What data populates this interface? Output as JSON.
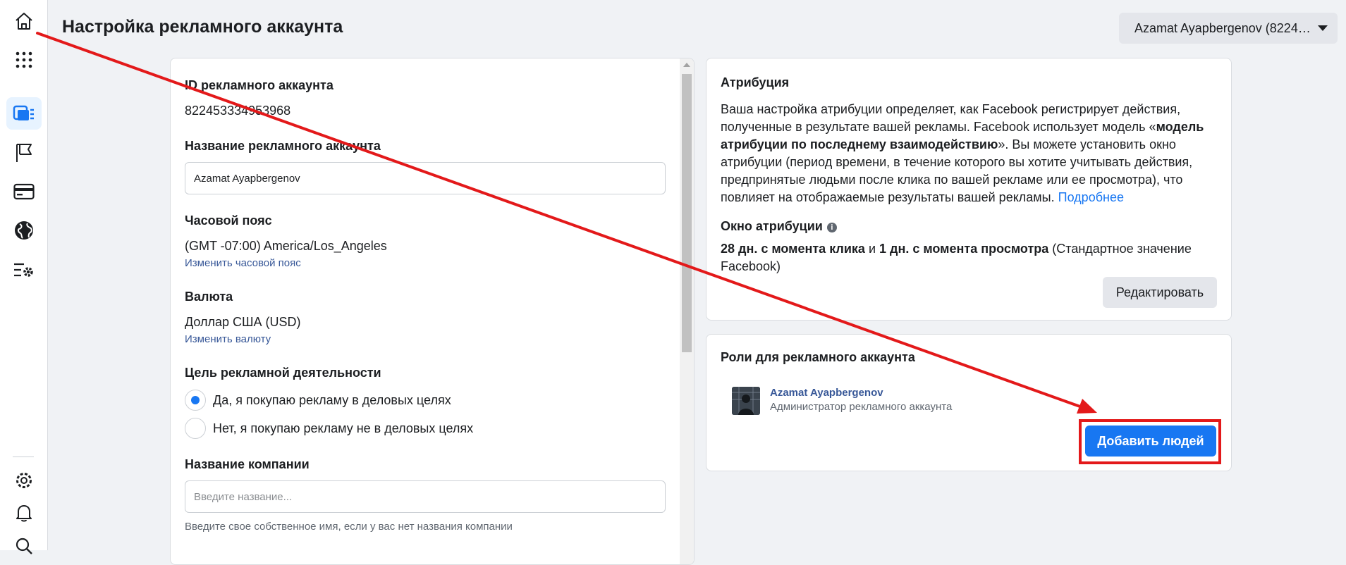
{
  "sidebar": {
    "icons": [
      "home-icon",
      "apps-grid-icon",
      "ads-manager-icon",
      "flag-icon",
      "billing-card-icon",
      "globe-icon",
      "settings-list-icon",
      "gear-icon",
      "bell-icon",
      "search-icon"
    ],
    "active": "ads-manager-icon",
    "accent": "#1877f2"
  },
  "header": {
    "title": "Настройка рекламного аккаунта",
    "account_switcher": "Azamat Ayapbergenov (82245..."
  },
  "account_info": {
    "id_label": "ID рекламного аккаунта",
    "id_value": "822453334953968",
    "name_label": "Название рекламного аккаунта",
    "name_value": "Azamat Ayapbergenov",
    "timezone_label": "Часовой пояс",
    "timezone_value": "(GMT -07:00) America/Los_Angeles",
    "timezone_link": "Изменить часовой пояс",
    "currency_label": "Валюта",
    "currency_value": "Доллар США (USD)",
    "currency_link": "Изменить валюту",
    "purpose_label": "Цель рекламной деятельности",
    "purpose_options": [
      {
        "label": "Да, я покупаю рекламу в деловых целях",
        "selected": true
      },
      {
        "label": "Нет, я покупаю рекламу не в деловых целях",
        "selected": false
      }
    ],
    "company_label": "Название компании",
    "company_placeholder": "Введите название...",
    "company_helper": "Введите свое собственное имя, если у вас нет названия компании"
  },
  "attribution": {
    "title": "Атрибуция",
    "desc_1": "Ваша настройка атрибуции определяет, как Facebook регистрирует действия, полученные в результате вашей рекламы. Facebook использует модель «",
    "desc_bold": "модель атрибуции по последнему взаимодействию",
    "desc_2": "». Вы можете установить окно атрибуции (период времени, в течение которого вы хотите учитывать действия, предпринятые людьми после клика по вашей рекламе или ее просмотра), что повлияет на отображаемые результаты вашей рекламы.",
    "learn_more": "Подробнее",
    "window_title": "Окно атрибуции",
    "window_click": "28 дн. с момента клика",
    "window_and": " и ",
    "window_view": "1 дн. с момента просмотра",
    "window_default": " (Стандартное значение Facebook)",
    "edit_button": "Редактировать"
  },
  "roles": {
    "title": "Роли для рекламного аккаунта",
    "user_name": "Azamat Ayapbergenov",
    "user_role": "Администратор рекламного аккаунта",
    "add_button": "Добавить людей"
  },
  "annotation": {
    "color": "#e3191a"
  }
}
